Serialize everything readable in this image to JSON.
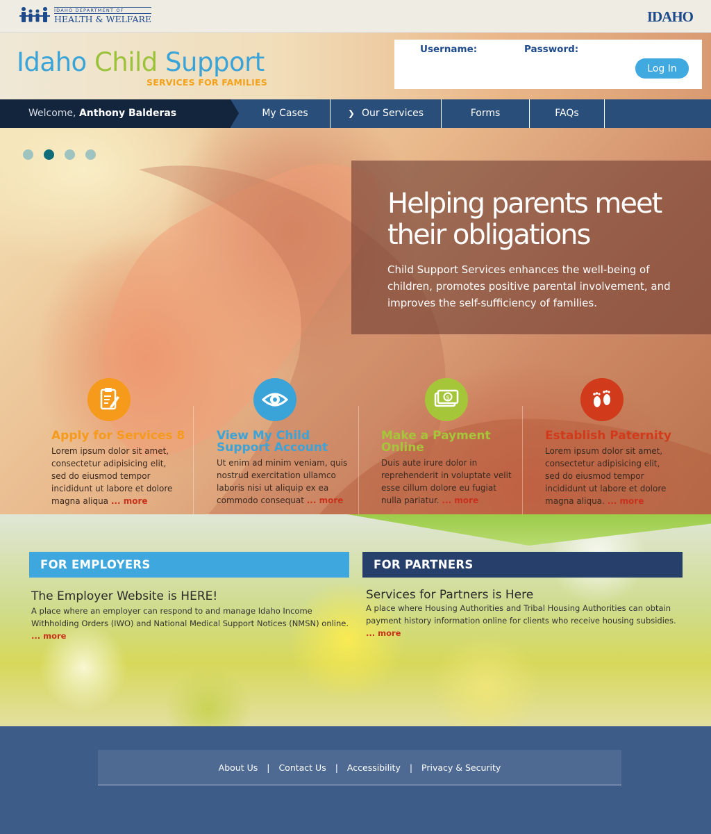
{
  "agency": {
    "line1": "IDAHO DEPARTMENT OF",
    "line2": "HEALTH & WELFARE",
    "state_logo": "IDAHO"
  },
  "site": {
    "title_part1": "Idaho",
    "title_part2": "Child",
    "title_part3": "Support",
    "subtitle": "SERVICES FOR FAMILIES"
  },
  "login": {
    "username_label": "Username:",
    "password_label": "Password:",
    "button_label": "Log In"
  },
  "nav": {
    "welcome_prefix": "Welcome,",
    "user_name": "Anthony Balderas",
    "items": [
      {
        "label": "My Cases"
      },
      {
        "label": "Our Services"
      },
      {
        "label": "Forms"
      },
      {
        "label": "FAQs"
      }
    ]
  },
  "hero": {
    "slides_total": 4,
    "active_slide": 2,
    "title": "Helping parents meet their obligations",
    "text": "Child Support Services enhances the well-being of children, promotes positive parental involvement, and improves the self-sufficiency of families."
  },
  "features": [
    {
      "icon": "clipboard-pen-icon",
      "color": "#f59a1b",
      "title": "Apply for Services 8",
      "text": "Lorem ipsum dolor sit amet, consectetur adipisicing elit, sed do eiusmod tempor incididunt ut labore et dolore magna aliqua",
      "more": "... more"
    },
    {
      "icon": "eye-icon",
      "color": "#3aa3d8",
      "title": "View My Child Support Account",
      "text": "Ut enim ad minim veniam, quis nostrud exercitation ullamco laboris nisi ut aliquip ex ea commodo consequat",
      "more": "... more"
    },
    {
      "icon": "money-icon",
      "color": "#a6c63a",
      "title": "Make a Payment Online",
      "text": "Duis aute irure dolor in reprehenderit in voluptate velit esse cillum dolore eu fugiat nulla pariatur.",
      "more": "... more"
    },
    {
      "icon": "baby-feet-icon",
      "color": "#d13a1a",
      "title": "Establish Paternity",
      "text": "Lorem ipsum dolor sit amet, consectetur adipisicing elit, sed do eiusmod tempor incididunt ut labore et dolore magna aliqua.",
      "more": "... more"
    }
  ],
  "employers": {
    "heading": "FOR EMPLOYERS",
    "title": "The Employer Website is HERE!",
    "text": "A place where an employer can respond to and manage Idaho Income Withholding Orders (IWO) and National Medical Support Notices (NMSN) online.",
    "more": "... more",
    "color": "#3ea7de"
  },
  "partners": {
    "heading": "FOR PARTNERS",
    "title": "Services for Partners is Here",
    "text": "A place where Housing Authorities and Tribal Housing Authorities can obtain payment history information online for clients who receive housing subsidies.",
    "more": "... more",
    "color": "#26406b"
  },
  "footer": {
    "links": [
      "About Us",
      "Contact Us",
      "Accessibility",
      "Privacy & Security"
    ],
    "separator": "|"
  }
}
